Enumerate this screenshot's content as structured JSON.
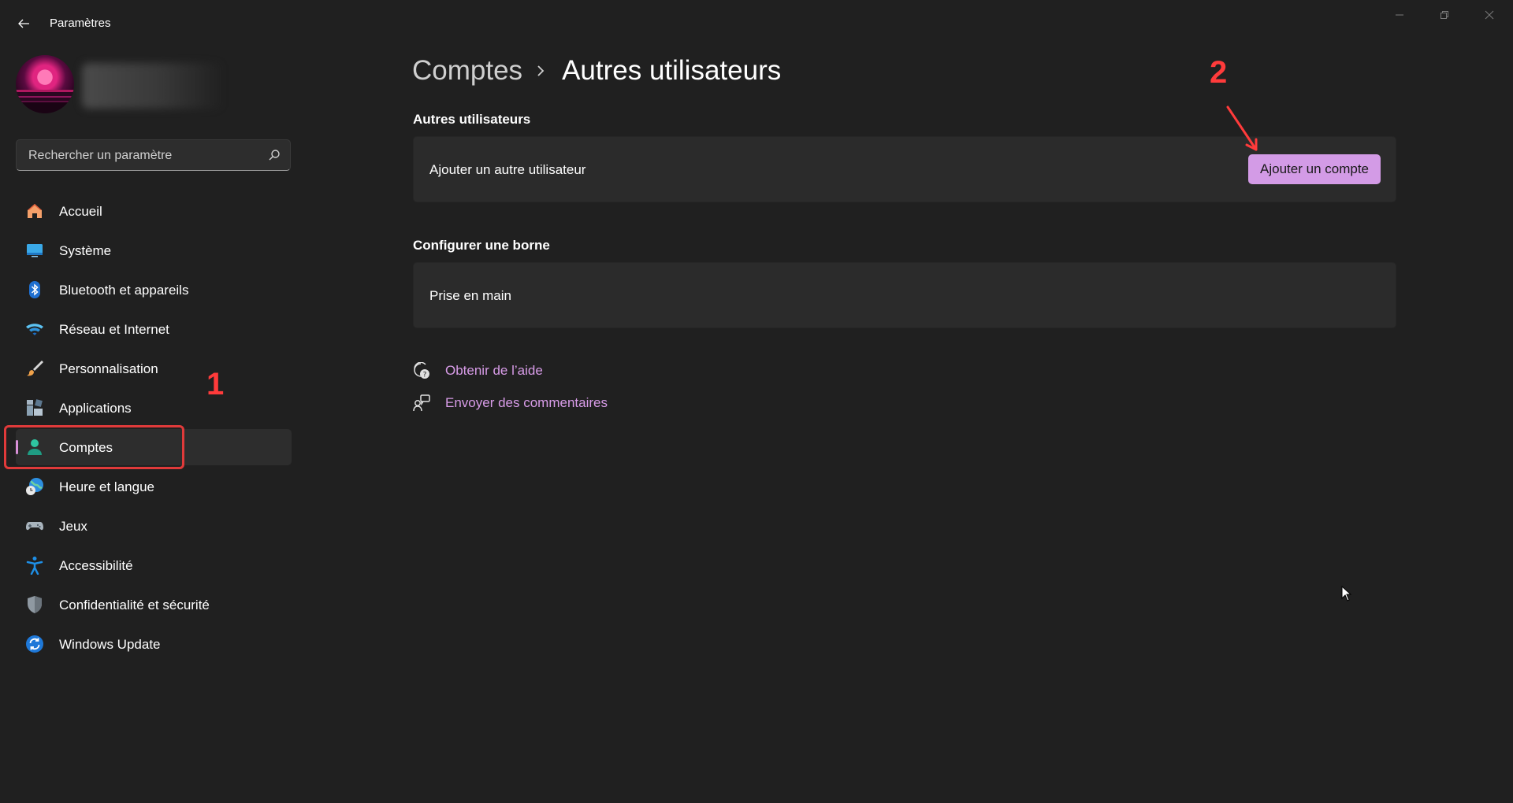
{
  "window": {
    "title": "Paramètres"
  },
  "search": {
    "placeholder": "Rechercher un paramètre"
  },
  "sidebar": {
    "items": [
      {
        "label": "Accueil",
        "icon": "home-icon"
      },
      {
        "label": "Système",
        "icon": "monitor-icon"
      },
      {
        "label": "Bluetooth et appareils",
        "icon": "bluetooth-icon"
      },
      {
        "label": "Réseau et Internet",
        "icon": "wifi-icon"
      },
      {
        "label": "Personnalisation",
        "icon": "brush-icon"
      },
      {
        "label": "Applications",
        "icon": "apps-icon"
      },
      {
        "label": "Comptes",
        "icon": "person-icon",
        "active": true
      },
      {
        "label": "Heure et langue",
        "icon": "globe-clock-icon"
      },
      {
        "label": "Jeux",
        "icon": "gamepad-icon"
      },
      {
        "label": "Accessibilité",
        "icon": "accessibility-icon"
      },
      {
        "label": "Confidentialité et sécurité",
        "icon": "shield-icon"
      },
      {
        "label": "Windows Update",
        "icon": "update-icon"
      }
    ]
  },
  "breadcrumb": {
    "parent": "Comptes",
    "current": "Autres utilisateurs"
  },
  "sections": {
    "other_users": {
      "title": "Autres utilisateurs",
      "card_label": "Ajouter un autre utilisateur",
      "button_label": "Ajouter un compte"
    },
    "kiosk": {
      "title": "Configurer une borne",
      "card_label": "Prise en main"
    }
  },
  "links": {
    "help": "Obtenir de l’aide",
    "feedback": "Envoyer des commentaires"
  },
  "annotations": {
    "step1": "1",
    "step2": "2"
  },
  "colors": {
    "background": "#202020",
    "card": "#2b2b2b",
    "accent": "#d39be6",
    "link": "#d89ce8",
    "annotation": "#ff3b3b"
  }
}
